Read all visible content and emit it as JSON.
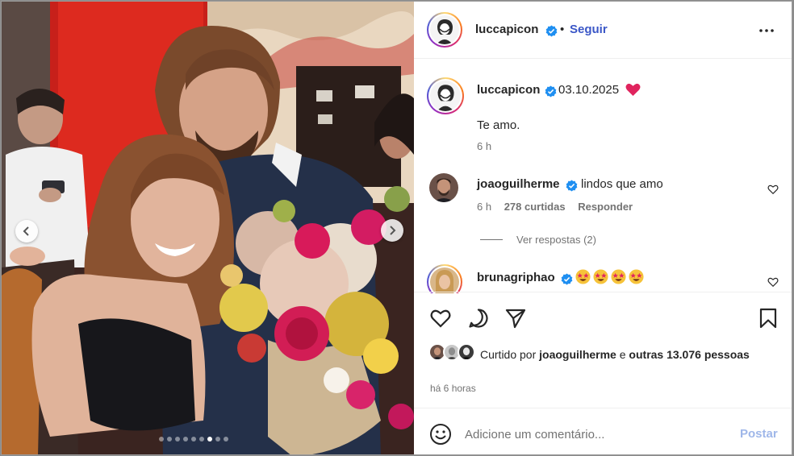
{
  "post": {
    "author": "luccapicon",
    "follow_label": "Seguir",
    "separator": "•",
    "more_icon": "more-horizontal-icon",
    "carousel": {
      "slide_count": 9,
      "active_slide": 6
    }
  },
  "caption": {
    "author": "luccapicon",
    "date": "03.10.2025",
    "text": "Te amo.",
    "time": "6 h"
  },
  "comments": [
    {
      "author": "joaoguilherme",
      "text": "lindos que amo",
      "time": "6 h",
      "likes": "278 curtidas",
      "reply_label": "Responder",
      "view_replies": "Ver respostas (2)"
    },
    {
      "author": "brunagriphao",
      "emojis": [
        "star-struck",
        "star-struck",
        "star-struck",
        "star-struck"
      ]
    }
  ],
  "likes": {
    "prefix": "Curtido por",
    "user": "joaoguilherme",
    "middle": "e",
    "others": "outras 13.076",
    "suffix": "pessoas"
  },
  "time_ago": "há 6 horas",
  "add_comment": {
    "placeholder": "Adicione um comentário...",
    "post_label": "Postar"
  },
  "colors": {
    "verified": "#1f8ff1",
    "follow": "#3b57c7",
    "heart": "#e0245e",
    "post_disabled": "#9fb7e9"
  }
}
